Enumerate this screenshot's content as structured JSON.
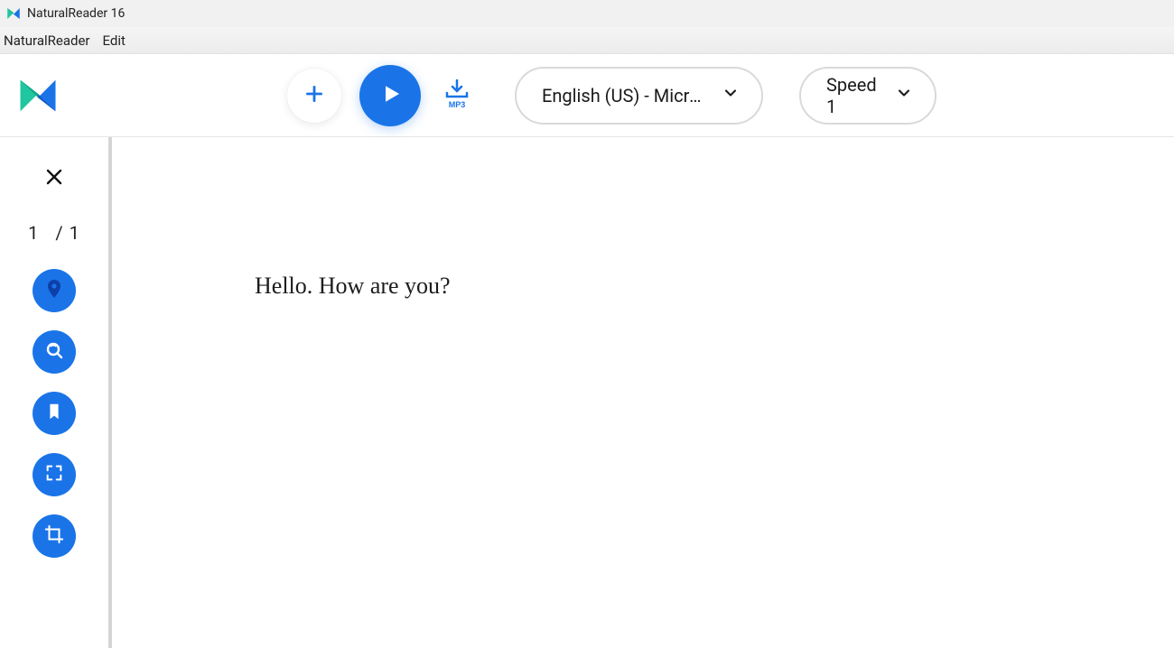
{
  "titlebar": {
    "title": "NaturalReader 16"
  },
  "menubar": {
    "items": [
      "NaturalReader",
      "Edit"
    ]
  },
  "toolbar": {
    "voice_label": "English (US) - Microsoft…",
    "speed_label": "Speed 1"
  },
  "sidebar": {
    "page_current": "1",
    "page_sep_total": "/ 1"
  },
  "document": {
    "text": "Hello. How are you?"
  },
  "colors": {
    "accent": "#1a74e8"
  }
}
